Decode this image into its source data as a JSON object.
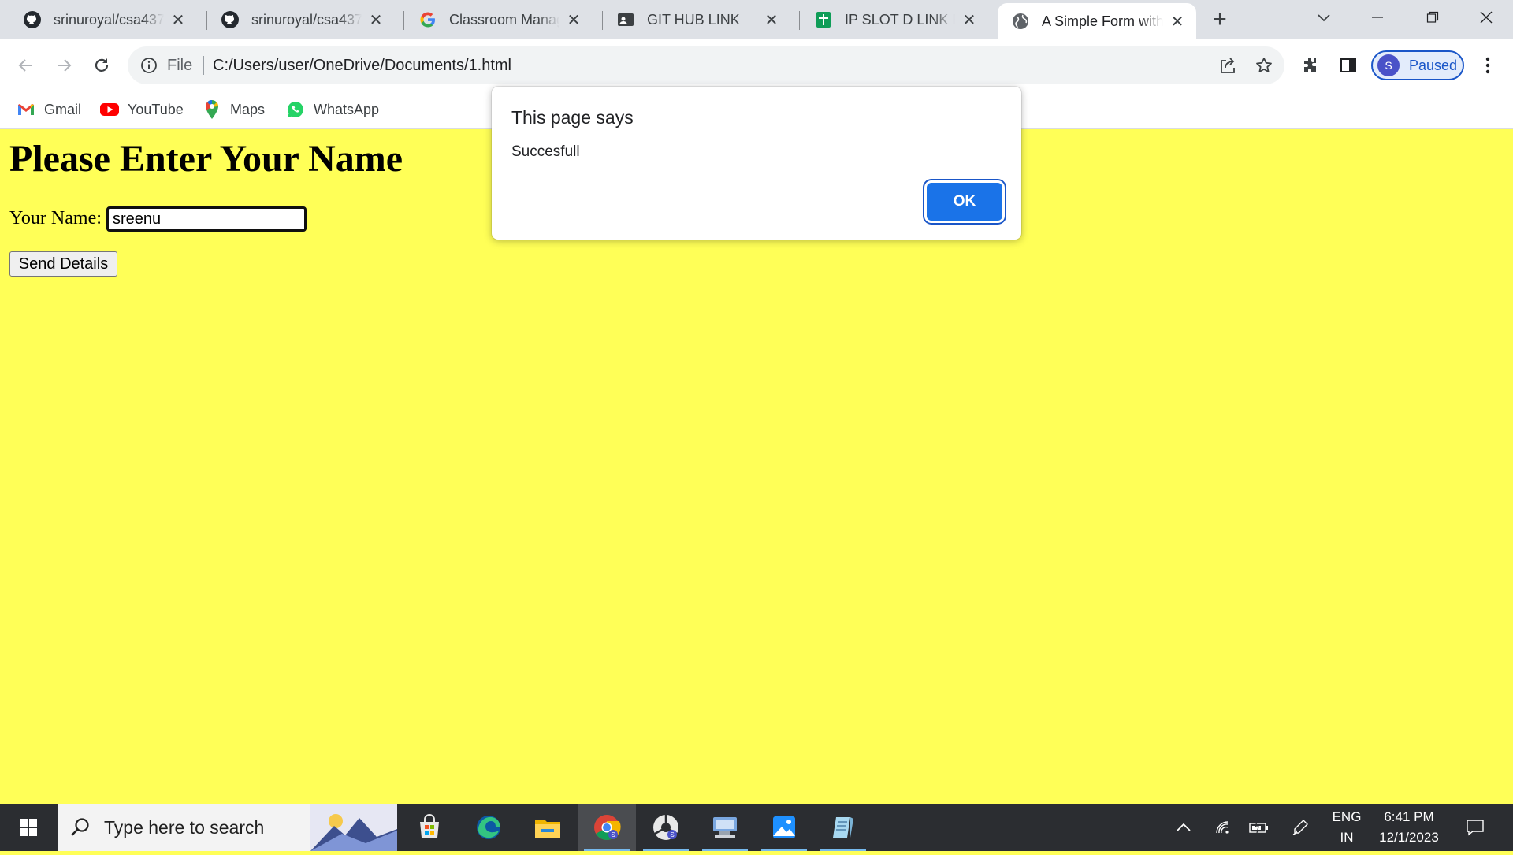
{
  "tabs": [
    {
      "title": "srinuroyal/csa4372",
      "icon": "github-icon"
    },
    {
      "title": "srinuroyal/csa4372",
      "icon": "github-icon"
    },
    {
      "title": "Classroom Manage",
      "icon": "google-icon"
    },
    {
      "title": "GIT HUB LINK",
      "icon": "contact-card-icon"
    },
    {
      "title": "IP SLOT D LINK FO",
      "icon": "sheets-icon"
    },
    {
      "title": "A Simple Form with",
      "icon": "globe-icon",
      "active": true
    }
  ],
  "omnibox": {
    "scheme_label": "File",
    "url": "C:/Users/user/OneDrive/Documents/1.html"
  },
  "profile": {
    "initial": "S",
    "label": "Paused"
  },
  "bookmarks": [
    {
      "label": "Gmail",
      "icon": "gmail-icon"
    },
    {
      "label": "YouTube",
      "icon": "youtube-icon"
    },
    {
      "label": "Maps",
      "icon": "maps-icon"
    },
    {
      "label": "WhatsApp",
      "icon": "whatsapp-icon"
    }
  ],
  "page": {
    "heading": "Please Enter Your Name",
    "name_label": "Your Name:",
    "name_value": "sreenu",
    "send_button": "Send Details"
  },
  "dialog": {
    "title": "This page says",
    "message": "Succesfull",
    "ok_label": "OK"
  },
  "taskbar": {
    "search_placeholder": "Type here to search",
    "apps": [
      "store-icon",
      "edge-icon",
      "file-explorer-icon",
      "chrome-icon",
      "chrome-profile-icon",
      "network-app-icon",
      "photos-icon",
      "notepad-icon"
    ],
    "language": {
      "line1": "ENG",
      "line2": "IN"
    },
    "clock": {
      "time": "6:41 PM",
      "date": "12/1/2023"
    }
  },
  "colors": {
    "page_background": "#ffff57",
    "accent": "#1a73e8",
    "taskbar": "#2b2d31"
  }
}
